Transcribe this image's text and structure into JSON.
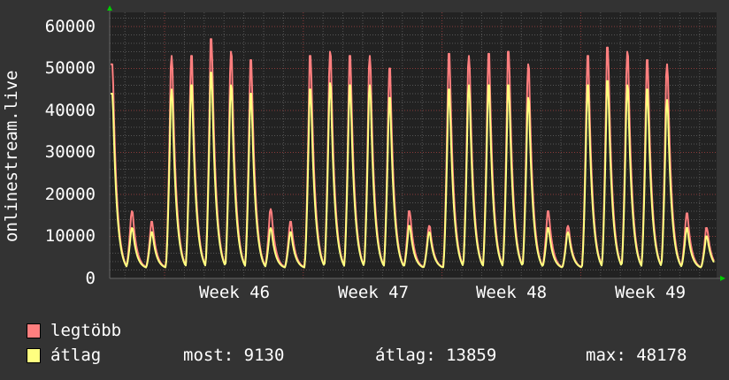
{
  "chart_data": {
    "type": "line",
    "ylabel": "onlinestream.live",
    "ylim": [
      0,
      62000
    ],
    "yticks": [
      "0",
      "10000",
      "20000",
      "30000",
      "40000",
      "50000",
      "60000"
    ],
    "xticks": [
      "Week 46",
      "Week 47",
      "Week 48",
      "Week 49"
    ],
    "grid": true,
    "x_unit": "day",
    "daily_min": 2500,
    "series": [
      {
        "name": "legtöbb",
        "color": "#ff7f7f",
        "daily_peaks": [
          51000,
          16000,
          13500,
          53000,
          53000,
          57000,
          54000,
          52000,
          16500,
          13500,
          53000,
          54000,
          53000,
          53000,
          50000,
          16000,
          12500,
          53500,
          53000,
          53500,
          54000,
          51000,
          16000,
          12500,
          53000,
          55000,
          54000,
          52000,
          51000,
          15500,
          12000
        ]
      },
      {
        "name": "átlag",
        "color": "#ffff80",
        "daily_peaks": [
          44000,
          12000,
          11000,
          45000,
          46000,
          49000,
          46000,
          44000,
          12000,
          11000,
          45000,
          46500,
          46000,
          46000,
          43000,
          12500,
          11000,
          45000,
          46000,
          46000,
          46000,
          43000,
          12000,
          11000,
          46000,
          47000,
          46000,
          45000,
          42500,
          12000,
          10000
        ]
      }
    ]
  },
  "legend": {
    "items": [
      {
        "label": "legtöbb",
        "color": "#ff7f7f"
      },
      {
        "label": "átlag",
        "color": "#ffff80"
      }
    ],
    "stats": {
      "current": "most: 9130",
      "average": "átlag: 13859",
      "max": "max: 48178"
    }
  },
  "colors": {
    "background": "#333333",
    "plot_background": "#222222",
    "major_grid": "#8a3a3a",
    "minor_grid": "#555555",
    "axis_arrow": "#00cc00"
  }
}
